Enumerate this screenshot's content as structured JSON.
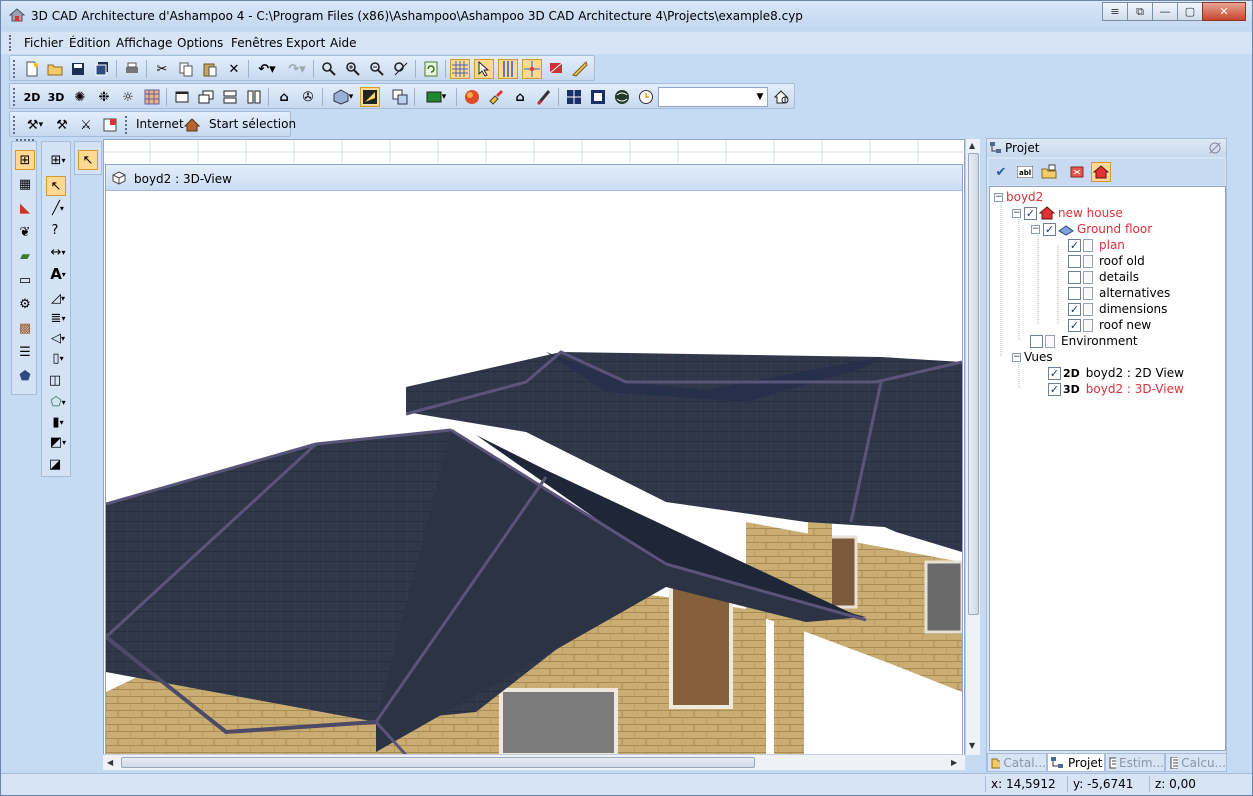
{
  "window": {
    "title": "3D CAD Architecture d'Ashampoo 4 - C:\\Program Files (x86)\\Ashampoo\\Ashampoo 3D CAD Architecture 4\\Projects\\example8.cyp",
    "caption_buttons": [
      "≡",
      "⧉",
      "—",
      "▢",
      "✕"
    ]
  },
  "menu": [
    "Fichier",
    "Édition",
    "Affichage",
    "Options",
    "Fenêtres",
    "Export",
    "Aide"
  ],
  "toolbar3": {
    "internet": "Internet",
    "start_selection": "Start sélection"
  },
  "toolbar2": {
    "label_2d": "2D",
    "label_3d": "3D"
  },
  "subwindow": {
    "title": "boyd2 : 3D-View"
  },
  "panel": {
    "title": "Projet",
    "tree": {
      "root": "boyd2",
      "house": "new house",
      "floor": "Ground floor",
      "layers": [
        {
          "label": "plan",
          "checked": true
        },
        {
          "label": "roof old",
          "checked": false
        },
        {
          "label": "details",
          "checked": false
        },
        {
          "label": "alternatives",
          "checked": false
        },
        {
          "label": "dimensions",
          "checked": true
        },
        {
          "label": "roof new",
          "checked": true
        }
      ],
      "environment": "Environment",
      "views": "Vues",
      "view_items": [
        {
          "badge": "2D",
          "label": "boyd2 : 2D View"
        },
        {
          "badge": "3D",
          "label": "boyd2 : 3D-View"
        }
      ]
    },
    "tabs": [
      "Catal...",
      "Projet",
      "Estim...",
      "Calcu..."
    ]
  },
  "status": {
    "x": "x: 14,5912",
    "y": "y: -5,6741",
    "z": "z: 0,00"
  },
  "colors": {
    "accent_selected": "#ffd892",
    "tree_highlight": "#d8323a",
    "roof": "#2c3447",
    "brick": "#c8a86a"
  }
}
